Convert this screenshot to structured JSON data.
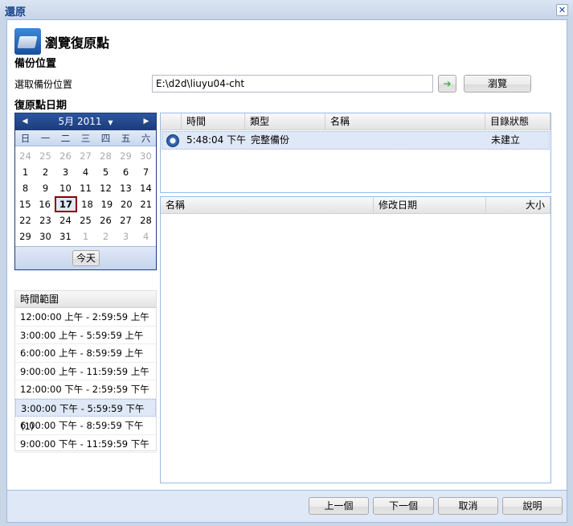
{
  "window": {
    "title": "還原",
    "close": "✕"
  },
  "header": {
    "title": "瀏覽復原點"
  },
  "backup_location": {
    "section": "備份位置",
    "label": "選取備份位置",
    "value": "E:\\d2d\\liuyu04-cht",
    "go": "➔",
    "browse": "瀏覽"
  },
  "recovery_date": {
    "section": "復原點日期"
  },
  "calendar": {
    "month_label": "5月 2011",
    "prev": "◀",
    "next": "▶",
    "dropdown": "▼",
    "weekdays": [
      "日",
      "一",
      "二",
      "三",
      "四",
      "五",
      "六"
    ],
    "weeks": [
      [
        "24",
        "25",
        "26",
        "27",
        "28",
        "29",
        "30"
      ],
      [
        "1",
        "2",
        "3",
        "4",
        "5",
        "6",
        "7"
      ],
      [
        "8",
        "9",
        "10",
        "11",
        "12",
        "13",
        "14"
      ],
      [
        "15",
        "16",
        "17",
        "18",
        "19",
        "20",
        "21"
      ],
      [
        "22",
        "23",
        "24",
        "25",
        "26",
        "27",
        "28"
      ],
      [
        "29",
        "30",
        "31",
        "1",
        "2",
        "3",
        "4"
      ]
    ],
    "selected": "17",
    "today": "今天"
  },
  "time_range": {
    "header": "時間範圍",
    "items": [
      "12:00:00 上午 - 2:59:59 上午",
      "3:00:00 上午 - 5:59:59 上午",
      "6:00:00 上午 - 8:59:59 上午",
      "9:00:00 上午 - 11:59:59 上午",
      "12:00:00 下午 - 2:59:59 下午",
      "3:00:00 下午 - 5:59:59 下午 (1)",
      "6:00:00 下午 - 8:59:59 下午",
      "9:00:00 下午 - 11:59:59 下午"
    ],
    "selected_index": 5
  },
  "points_grid": {
    "columns": [
      "時間",
      "類型",
      "名稱",
      "目錄狀態"
    ],
    "rows": [
      {
        "time": "5:48:04 下午",
        "type": "完整備份",
        "name": "",
        "status": "未建立"
      }
    ]
  },
  "files_grid": {
    "columns": [
      "名稱",
      "修改日期",
      "大小"
    ]
  },
  "footer": {
    "prev": "上一個",
    "next": "下一個",
    "cancel": "取消",
    "help": "說明"
  }
}
